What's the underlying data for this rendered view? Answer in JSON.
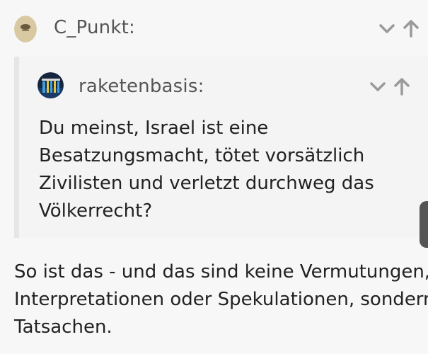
{
  "post": {
    "author": "C_Punkt:",
    "quote": {
      "author": "raketenbasis:",
      "lines": [
        "Du meinst, Israel ist eine",
        "Besatzungsmacht, tötet vorsätzlich",
        "Zivilisten und verletzt durchweg das",
        "Völkerrecht?"
      ]
    },
    "body_lines": [
      "So ist das - und das sind keine Vermutungen,",
      "Interpretationen oder Spekulationen, sondern",
      "Tatsachen."
    ]
  },
  "icons": {
    "expand": "chevron-down-icon",
    "jump": "arrow-up-icon"
  },
  "colors": {
    "background": "#f7f7f7",
    "quote_border": "#e6e6e6",
    "icon_gray": "#9a9a9a"
  }
}
